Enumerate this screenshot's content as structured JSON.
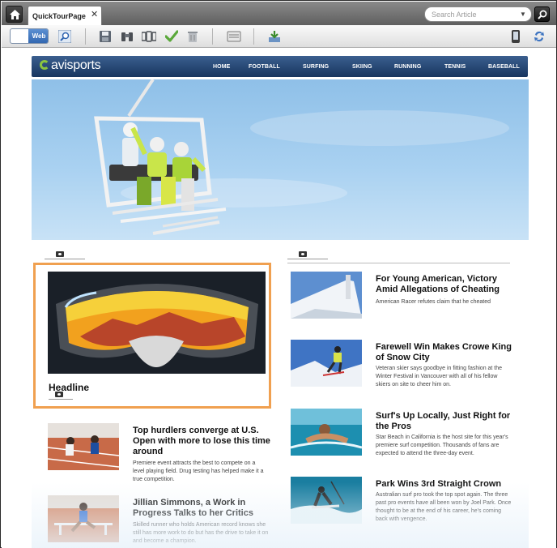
{
  "tab": {
    "label": "QuickTourPage",
    "close": "✕"
  },
  "search": {
    "placeholder": "Search Article"
  },
  "toolbar": {
    "web_label": "Web"
  },
  "site": {
    "logo": "avisports",
    "nav": [
      "HOME",
      "FOOTBALL",
      "SURFING",
      "SKIING",
      "RUNNING",
      "TENNIS",
      "BASEBALL"
    ]
  },
  "featured": {
    "headline": "Headline"
  },
  "left_articles": [
    {
      "title": "Top hurdlers converge at U.S. Open with more to lose this time around",
      "desc": "Premiere event attracts the best to compete on a level playing field. Drug testing has helped make it a true competition."
    },
    {
      "title": "Jillian Simmons, a Work in Progress Talks to her Critics",
      "desc": "Skilled runner who holds American record knows she still has more work to do but has the drive to take it on and become a champion."
    }
  ],
  "right_articles": [
    {
      "title": "For Young American, Victory Amid Allegations of Cheating",
      "desc": "American Racer refutes claim that he cheated"
    },
    {
      "title": "Farewell Win Makes Crowe King of Snow City",
      "desc": "Veteran skier says goodbye in fitting fashion at the Winter Festival in Vancouver with all of his fellow skiers on site to cheer him on."
    },
    {
      "title": "Surf's Up Locally, Just Right for the Pros",
      "desc": "Star Beach in California is the host site for this year's premiere surf competition. Thousands of fans are expected to attend the three-day event."
    },
    {
      "title": "Park Wins 3rd Straight Crown",
      "desc": "Australian surf pro took the top spot again. The three past pro events have all been won by Joel Park. Once thought to be at the end of his career, he's coming back with vengence."
    }
  ]
}
